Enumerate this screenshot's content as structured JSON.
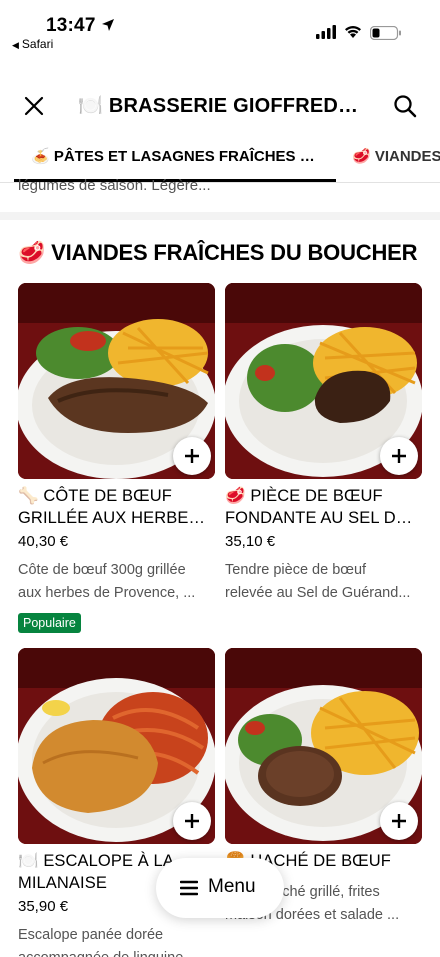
{
  "status_bar": {
    "time": "13:47",
    "back_app": "Safari"
  },
  "header": {
    "title": "🍽️ BRASSERIE GIOFFREDO – NICE"
  },
  "tabs": [
    {
      "label": "🍝 PÂTES ET LASAGNES FRAÎCHES MAISON",
      "active": true
    },
    {
      "label": "🥩 VIANDES FRAÎCHES DU BOUCHER",
      "active": false
    }
  ],
  "previous_section": {
    "desc_fragment": "légumes de saison. Légère..."
  },
  "section": {
    "title": "🥩 VIANDES FRAÎCHES DU BOUCHER"
  },
  "items": [
    {
      "name_line1": "🦴 CÔTE DE BŒUF",
      "name_line2": "GRILLÉE AUX HERBES ...",
      "price": "40,30 €",
      "desc_line1": "Côte de bœuf 300g grillée",
      "desc_line2": "aux herbes de Provence, ...",
      "badge": "Populaire"
    },
    {
      "name_line1": "🥩 PIÈCE DE BŒUF",
      "name_line2": "FONDANTE AU SEL DE ...",
      "price": "35,10 €",
      "desc_line1": "Tendre pièce de bœuf",
      "desc_line2": "relevée au Sel de Guérand..."
    },
    {
      "name_line1": "🍽️ ESCALOPE À LA",
      "name_line2": "MILANAISE",
      "price": "35,90 €",
      "desc_line1": "Escalope panée dorée",
      "desc_line2": "accompagnée de linguine..."
    },
    {
      "name_line1": "🍔 HACHÉ DE BŒUF",
      "name_line2": "",
      "price": "",
      "desc_line1": "Steak haché grillé, frites",
      "desc_line2": "maison dorées et salade ..."
    }
  ],
  "floating_menu": {
    "label": "Menu"
  },
  "colors": {
    "badge_green": "#06843f",
    "text_secondary": "#545454",
    "plate_background": "#7a1212"
  }
}
